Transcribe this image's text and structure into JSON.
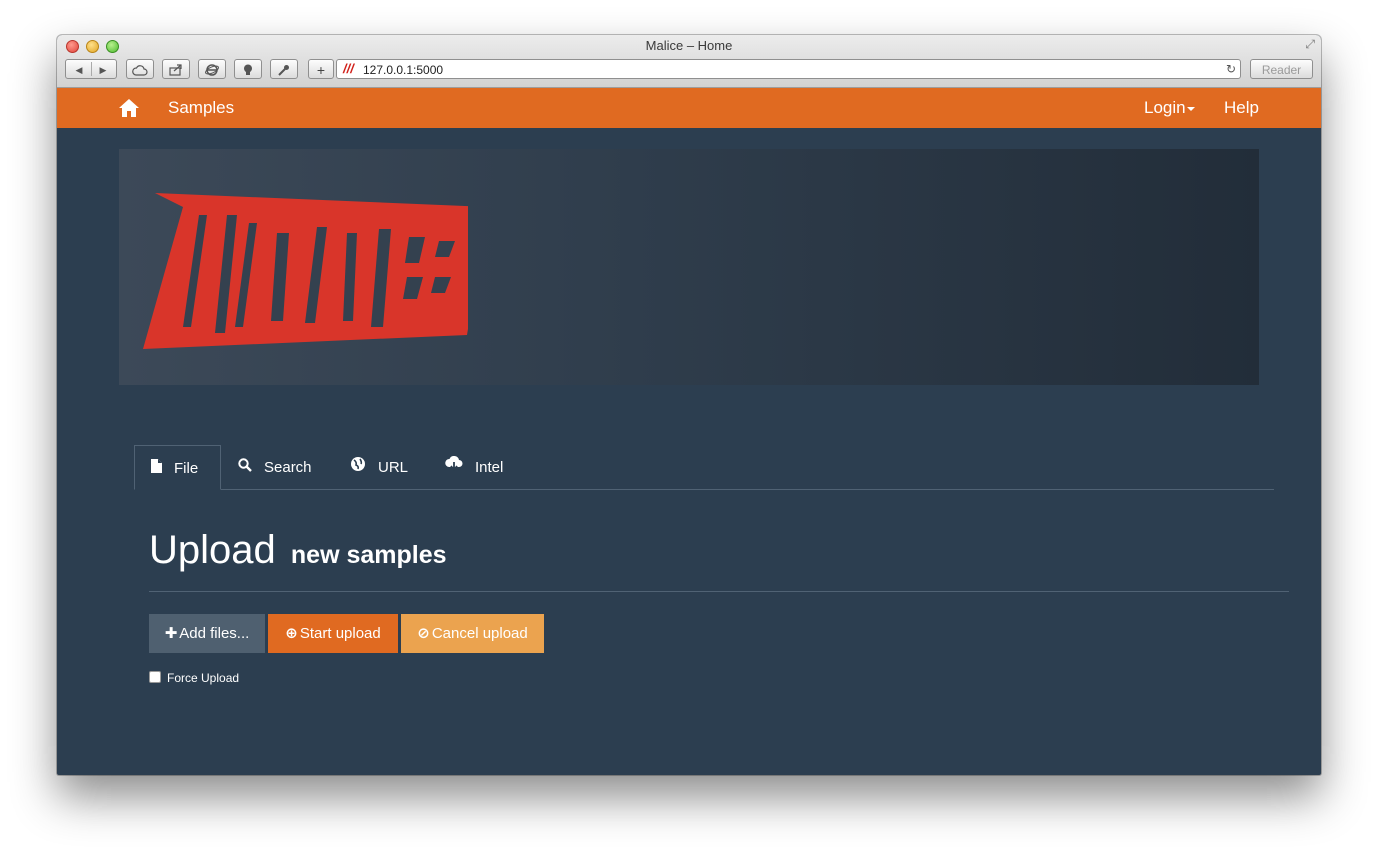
{
  "browser": {
    "window_title": "Malice – Home",
    "url": "127.0.0.1:5000",
    "reader_label": "Reader",
    "new_tab_label": "+"
  },
  "navbar": {
    "home_icon": "home-icon",
    "samples_label": "Samples",
    "login_label": "Login",
    "help_label": "Help",
    "color": "#e06a21"
  },
  "banner": {
    "logo_text": "MALICE",
    "logo_color": "#d9352a"
  },
  "tabs": [
    {
      "label": "File",
      "icon": "file-icon",
      "active": true
    },
    {
      "label": "Search",
      "icon": "search-icon",
      "active": false
    },
    {
      "label": "URL",
      "icon": "globe-icon",
      "active": false
    },
    {
      "label": "Intel",
      "icon": "cloud-download-icon",
      "active": false
    }
  ],
  "upload": {
    "title": "Upload",
    "subtitle": "new samples",
    "add_files_label": "Add files...",
    "start_upload_label": "Start upload",
    "cancel_upload_label": "Cancel upload",
    "force_upload_label": "Force Upload"
  },
  "colors": {
    "page_bg": "#2c3e50",
    "accent": "#e06a21",
    "cancel": "#eba34f",
    "secondary": "#4f6070"
  }
}
